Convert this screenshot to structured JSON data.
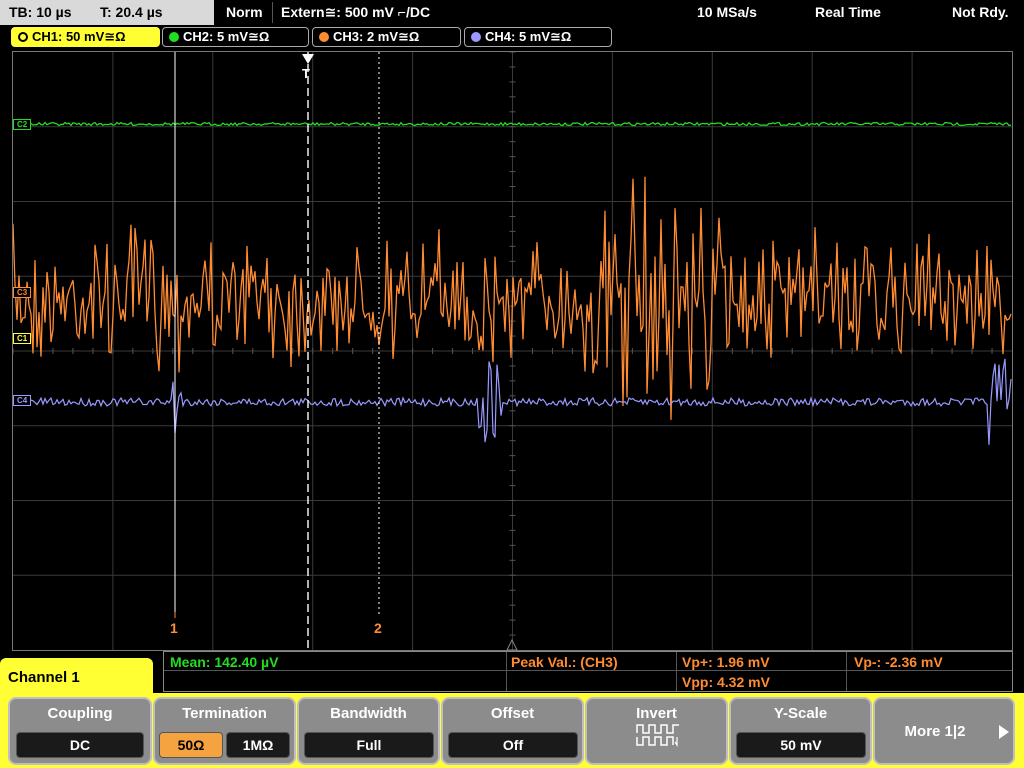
{
  "status": {
    "timebase": "TB: 10 µs",
    "trigger_time": "T: 20.4 µs",
    "trigger_mode": "Norm",
    "trigger_source": "Extern≅: 500 mV ⌐/DC",
    "sample_rate": "10 MSa/s",
    "acq_mode": "Real Time",
    "ready_state": "Not Rdy."
  },
  "channels": [
    {
      "label": "CH1: 50 mV≅Ω",
      "color": "#ffff33",
      "ref": "C1",
      "active": true
    },
    {
      "label": "CH2: 5 mV≅Ω",
      "color": "#22dd22",
      "ref": "C2",
      "active": false
    },
    {
      "label": "CH3: 2 mV≅Ω",
      "color": "#ff8c33",
      "ref": "C3",
      "active": false
    },
    {
      "label": "CH4: 5 mV≅Ω",
      "color": "#9999ff",
      "ref": "C4",
      "active": false
    }
  ],
  "cursors": {
    "cursor1": "1",
    "cursor2": "2",
    "trigger_marker": "T"
  },
  "measurements": {
    "mean": "Mean: 142.40 µV",
    "peak_title": "Peak Val.:  (CH3)",
    "vp_plus": "Vp+: 1.96 mV",
    "vp_minus": "Vp-: -2.36 mV",
    "vpp": "Vpp: 4.32 mV"
  },
  "menu": {
    "channel_title": "Channel 1",
    "coupling": {
      "label": "Coupling",
      "value": "DC"
    },
    "termination": {
      "label": "Termination",
      "option_a": "50Ω",
      "option_b": "1MΩ",
      "selected": "50Ω"
    },
    "bandwidth": {
      "label": "Bandwidth",
      "value": "Full"
    },
    "offset": {
      "label": "Offset",
      "value": "Off"
    },
    "invert": {
      "label": "Invert"
    },
    "yscale": {
      "label": "Y-Scale",
      "value": "50 mV"
    },
    "more": {
      "label": "More 1|2"
    }
  }
}
